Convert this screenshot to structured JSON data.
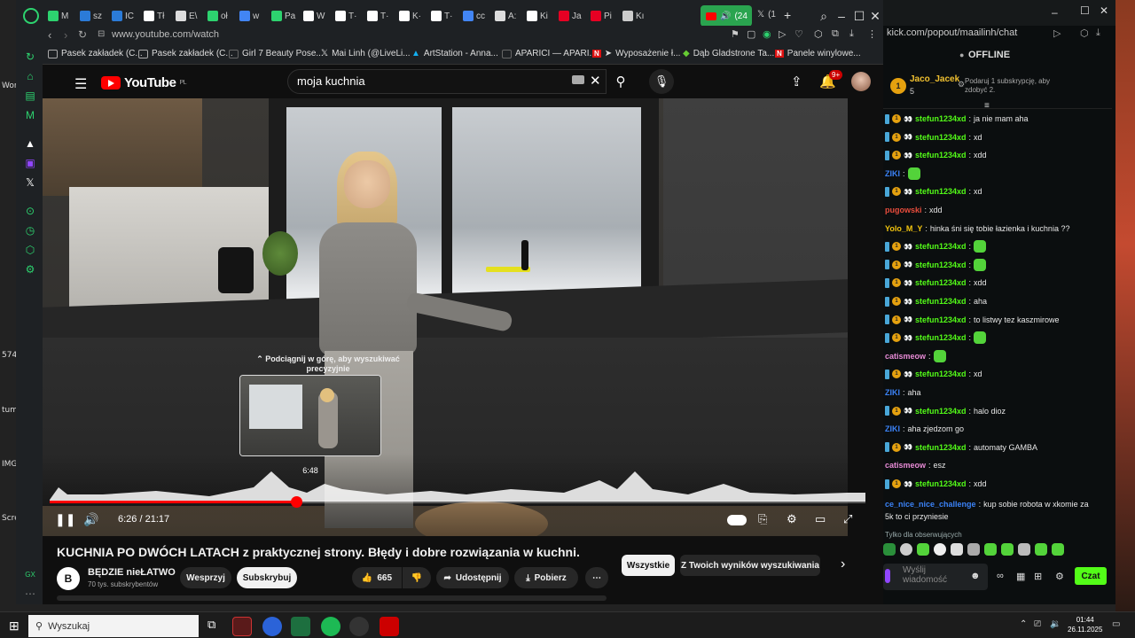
{
  "desktop": {
    "labels": [
      "Wor",
      "5745",
      "tumb",
      "IMG",
      "Scre"
    ]
  },
  "browser": {
    "tabs": [
      {
        "label": "M",
        "color": "#2dd36f"
      },
      {
        "label": "sz",
        "color": "#2b7bd8"
      },
      {
        "label": "IC",
        "color": "#2b7bd8"
      },
      {
        "label": "Tł",
        "color": "#ffffff"
      },
      {
        "label": "E\\",
        "color": "#dddddd"
      },
      {
        "label": "oł",
        "color": "#2dd36f"
      },
      {
        "label": "w",
        "color": "#4285f4"
      },
      {
        "label": "Pa",
        "color": "#2dd36f"
      },
      {
        "label": "W",
        "color": "#ffffff"
      },
      {
        "label": "T·",
        "color": "#ffffff"
      },
      {
        "label": "T·",
        "color": "#ffffff"
      },
      {
        "label": "K·",
        "color": "#ffffff"
      },
      {
        "label": "T·",
        "color": "#ffffff"
      },
      {
        "label": "cc",
        "color": "#4285f4"
      },
      {
        "label": "A:",
        "color": "#dddddd"
      },
      {
        "label": "Ki",
        "color": "#ffffff"
      },
      {
        "label": "Ja",
        "color": "#e60023"
      },
      {
        "label": "Pi",
        "color": "#e60023"
      },
      {
        "label": "Kı",
        "color": "#cccccc"
      }
    ],
    "active_tab": "(24",
    "extra_tab": "(1",
    "url": "www.youtube.com/watch",
    "bookmarks": [
      "Pasek zakładek (C...",
      "Pasek zakładek (C...",
      "Girl 7 Beauty Pose...",
      "Mai Linh (@LiveLi...",
      "ArtStation - Anna...",
      "APARICI — APARI...",
      "Wyposażenie ł...",
      "Dąb Gladstrone Ta...",
      "Panele winylowe..."
    ]
  },
  "youtube": {
    "logo_text": "YouTube",
    "logo_region": "PL",
    "search_value": "moja kuchnia",
    "notif_count": "9+",
    "seek_hint": "⌃ Podciągnij w górę, aby wyszukiwać precyzyjnie",
    "thumb_time": "6:48",
    "time_display": "6:26 / 21:17",
    "progress_fraction": 0.302,
    "title": "KUCHNIA PO DWÓCH LATACH z praktycznej strony. Błędy i dobre rozwiązania w kuchni.",
    "channel_initial": "B",
    "channel_name": "BĘDZIE nieŁATWO",
    "channel_subs": "70 tys. subskrybentów",
    "support_label": "Wesprzyj",
    "subscribe_label": "Subskrybuj",
    "like_count": "665",
    "share_label": "Udostępnij",
    "download_label": "Pobierz",
    "chip_all": "Wszystkie",
    "chip_search": "Z Twoich wyników wyszukiwania"
  },
  "kick": {
    "url": "kick.com/popout/maailinh/chat",
    "status": "OFFLINE",
    "pinned_user": "Jaco_Jacek",
    "pinned_count": "5",
    "pinned_text": "Podaruj 1 subskrypcję, aby zdobyć 2.",
    "messages": [
      {
        "user": "stefun1234xd",
        "text": "ja nie mam aha",
        "color": "#53fc18",
        "badges": true,
        "emote": false
      },
      {
        "user": "stefun1234xd",
        "text": "xd",
        "color": "#53fc18",
        "badges": true,
        "emote": false
      },
      {
        "user": "stefun1234xd",
        "text": "xdd",
        "color": "#53fc18",
        "badges": true,
        "emote": false
      },
      {
        "user": "ZIKI",
        "text": "",
        "color": "#3b82f6",
        "badges": false,
        "emote": true
      },
      {
        "user": "stefun1234xd",
        "text": "xd",
        "color": "#53fc18",
        "badges": true,
        "emote": false
      },
      {
        "user": "pugowski",
        "text": "xdd",
        "color": "#e74c3c",
        "badges": false,
        "emote": false
      },
      {
        "user": "Yolo_M_Y",
        "text": "hinka śni się tobie łazienka i kuchnia ??",
        "color": "#f1c40f",
        "badges": false,
        "emote": false
      },
      {
        "user": "stefun1234xd",
        "text": "",
        "color": "#53fc18",
        "badges": true,
        "emote": true
      },
      {
        "user": "stefun1234xd",
        "text": "",
        "color": "#53fc18",
        "badges": true,
        "emote": true
      },
      {
        "user": "stefun1234xd",
        "text": "xdd",
        "color": "#53fc18",
        "badges": true,
        "emote": false
      },
      {
        "user": "stefun1234xd",
        "text": "aha",
        "color": "#53fc18",
        "badges": true,
        "emote": false
      },
      {
        "user": "stefun1234xd",
        "text": "to listwy tez kaszmirowe",
        "color": "#53fc18",
        "badges": true,
        "emote": false
      },
      {
        "user": "stefun1234xd",
        "text": "",
        "color": "#53fc18",
        "badges": true,
        "emote": true
      },
      {
        "user": "catismeow",
        "text": "",
        "color": "#e88bd6",
        "badges": false,
        "emote": true
      },
      {
        "user": "stefun1234xd",
        "text": "xd",
        "color": "#53fc18",
        "badges": true,
        "emote": false
      },
      {
        "user": "ZIKI",
        "text": "aha",
        "color": "#3b82f6",
        "badges": false,
        "emote": false
      },
      {
        "user": "stefun1234xd",
        "text": "halo dioz",
        "color": "#53fc18",
        "badges": true,
        "emote": false
      },
      {
        "user": "ZIKI",
        "text": "aha zjedzom go",
        "color": "#3b82f6",
        "badges": false,
        "emote": false
      },
      {
        "user": "stefun1234xd",
        "text": "automaty GAMBA",
        "color": "#53fc18",
        "badges": true,
        "emote": false
      },
      {
        "user": "catismeow",
        "text": "esz",
        "color": "#e88bd6",
        "badges": false,
        "emote": false
      },
      {
        "user": "stefun1234xd",
        "text": "xdd",
        "color": "#53fc18",
        "badges": true,
        "emote": false
      }
    ],
    "last_user": "ce_nice_nice_challenge",
    "last_text": "kup sobie robota w xkomie za",
    "last_text2": "5k to ci przyniesie",
    "followers_only": "Tylko dla obserwujących",
    "input_placeholder": "Wyślij wiadomość",
    "send_label": "Czat"
  },
  "taskbar": {
    "search_placeholder": "Wyszukaj",
    "time": "01:44",
    "date": "26.11.2025"
  }
}
